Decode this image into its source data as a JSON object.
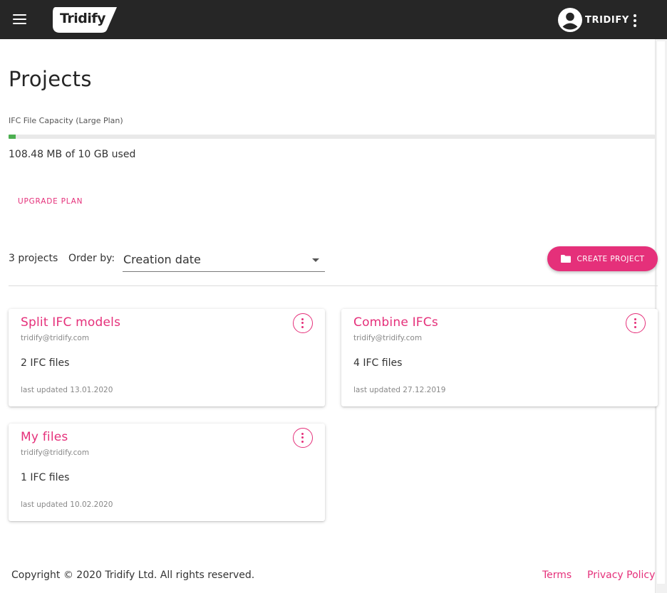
{
  "header": {
    "logo_text": "Tridify",
    "user_name": "TRIDIFY",
    "icons": {
      "menu": "hamburger-menu-icon",
      "account": "account-circle-icon",
      "more": "more-vert-icon"
    }
  },
  "page": {
    "title": "Projects",
    "capacity_label": "IFC File Capacity (Large Plan)",
    "capacity_used_fraction": 0.0106,
    "capacity_text": "108.48 MB of 10 GB used",
    "upgrade_label": "UPGRADE PLAN"
  },
  "toolbar": {
    "count_text": "3 projects",
    "order_label": "Order by:",
    "order_value": "Creation date",
    "create_label": "CREATE PROJECT",
    "create_icon": "folder-icon"
  },
  "projects": [
    {
      "title": "Split IFC models",
      "owner": "tridify@tridify.com",
      "files": "2 IFC files",
      "updated": "last updated 13.01.2020"
    },
    {
      "title": "Combine IFCs",
      "owner": "tridify@tridify.com",
      "files": "4 IFC files",
      "updated": "last updated 27.12.2019"
    },
    {
      "title": "My files",
      "owner": "tridify@tridify.com",
      "files": "1 IFC files",
      "updated": "last updated 10.02.2020"
    }
  ],
  "footer": {
    "copyright": "Copyright © 2020 Tridify Ltd. All rights reserved.",
    "terms": "Terms",
    "privacy": "Privacy Policy"
  },
  "colors": {
    "accent": "#e5307a",
    "header_bg": "#262626",
    "progress": "#4caf50",
    "progress_track": "#e9e9e9"
  }
}
